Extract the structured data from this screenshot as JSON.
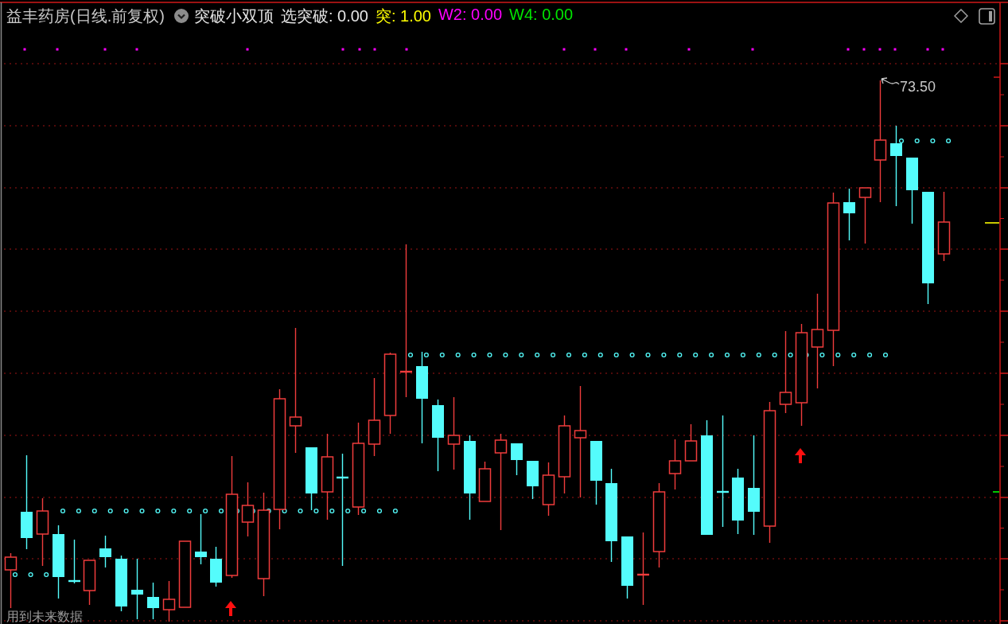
{
  "header": {
    "title": "益丰药房(日线.前复权)",
    "indicator": "突破小双顶",
    "readings": [
      {
        "text": "选突破: 0.00",
        "color": "#e6e6e6"
      },
      {
        "text": "突: 1.00",
        "color": "#ffff00"
      },
      {
        "text": "W2: 0.00",
        "color": "#ff00ff"
      },
      {
        "text": "W4: 0.00",
        "color": "#00e600"
      }
    ]
  },
  "chart": {
    "high_label": "73.50"
  },
  "note": "用到未来数据"
}
